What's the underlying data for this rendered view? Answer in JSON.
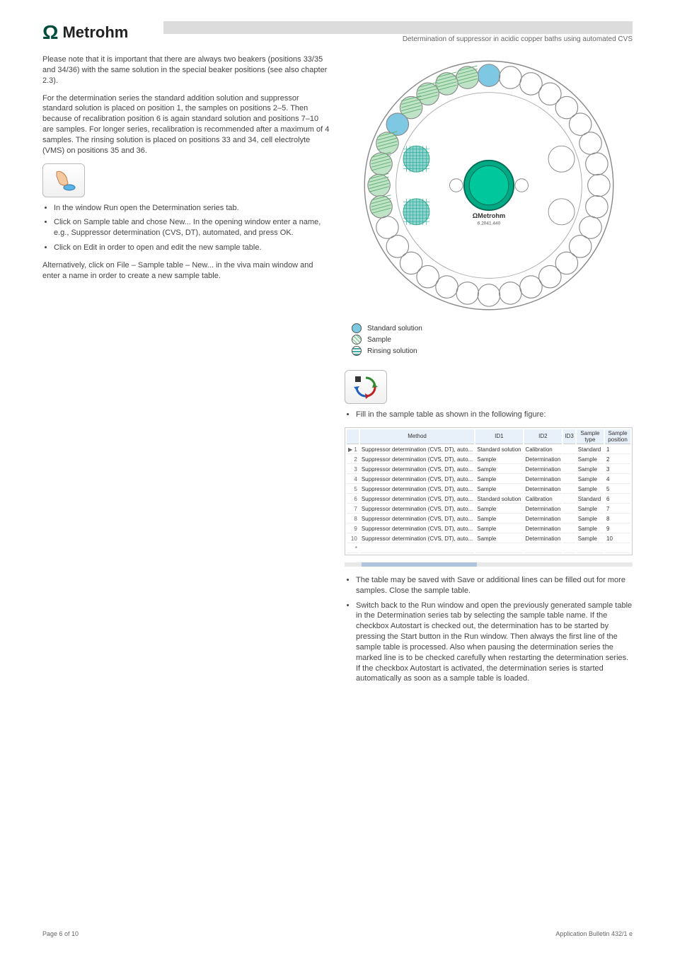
{
  "header": {
    "brand": "Metrohm",
    "subtitle": "Determination of suppressor in acidic copper baths using automated CVS"
  },
  "left": {
    "p1": "Please note that it is important that there are always two beakers (positions 33/35 and 34/36) with the same solution in the special beaker positions (see also chapter 2.3).",
    "p2": "For the determination series the standard addition solution and suppressor standard solution is placed on position 1, the samples on positions 2–5. Then because of recalibration position 6 is again standard solution and positions 7–10 are samples. For longer series, recalibration is recommended after a maximum of 4 samples. The rinsing solution is placed on positions 33 and 34, cell electrolyte (VMS) on positions 35 and 36.",
    "p3_heading": "",
    "list1": [
      "In the window Run open the Determination series tab.",
      "Click on Sample table and chose New... In the opening window enter a name, e.g., Suppressor determination (CVS, DT), automated, and press OK.",
      "Click on Edit in order to open and edit the new sample table."
    ],
    "p4": "Alternatively, click on File – Sample table – New... in the viva main window and enter a name in order to create a new sample table."
  },
  "right": {
    "carousel": {
      "brand_center": "Metrohm",
      "model": "6.2041.440",
      "std_positions": [
        1,
        6
      ],
      "sample_positions": [
        2,
        3,
        4,
        5,
        7,
        8,
        9,
        10
      ],
      "rinse_positions": [
        33,
        34
      ],
      "vms_positions": [
        35,
        36
      ],
      "total_outer": 32
    },
    "legend": {
      "std": "Standard solution",
      "sample": "Sample",
      "rinse": "Rinsing solution"
    },
    "list1": [
      "Fill in the sample table as shown in the following figure:"
    ],
    "table": {
      "headers": [
        "",
        "Method",
        "ID1",
        "ID2",
        "ID3",
        "Sample type",
        "Sample position"
      ],
      "rows": [
        [
          "1",
          "Suppressor determination (CVS, DT), auto...",
          "Standard solution",
          "Calibration",
          "",
          "Standard",
          "1"
        ],
        [
          "2",
          "Suppressor determination (CVS, DT), auto...",
          "Sample",
          "Determination",
          "",
          "Sample",
          "2"
        ],
        [
          "3",
          "Suppressor determination (CVS, DT), auto...",
          "Sample",
          "Determination",
          "",
          "Sample",
          "3"
        ],
        [
          "4",
          "Suppressor determination (CVS, DT), auto...",
          "Sample",
          "Determination",
          "",
          "Sample",
          "4"
        ],
        [
          "5",
          "Suppressor determination (CVS, DT), auto...",
          "Sample",
          "Determination",
          "",
          "Sample",
          "5"
        ],
        [
          "6",
          "Suppressor determination (CVS, DT), auto...",
          "Standard solution",
          "Calibration",
          "",
          "Standard",
          "6"
        ],
        [
          "7",
          "Suppressor determination (CVS, DT), auto...",
          "Sample",
          "Determination",
          "",
          "Sample",
          "7"
        ],
        [
          "8",
          "Suppressor determination (CVS, DT), auto...",
          "Sample",
          "Determination",
          "",
          "Sample",
          "8"
        ],
        [
          "9",
          "Suppressor determination (CVS, DT), auto...",
          "Sample",
          "Determination",
          "",
          "Sample",
          "9"
        ],
        [
          "10",
          "Suppressor determination (CVS, DT), auto...",
          "Sample",
          "Determination",
          "",
          "Sample",
          "10"
        ],
        [
          "*",
          "",
          "",
          "",
          "",
          "",
          ""
        ]
      ]
    },
    "list2": [
      "The table may be saved with Save or additional lines can be filled out for more samples. Close the sample table.",
      "Switch back to the Run window and open the previously generated sample table in the Determination series tab by selecting the sample table name. If the checkbox Autostart is checked out, the determination has to be started by pressing the Start button in the Run window. Then always the first line of the sample table is processed. Also when pausing the determination series the marked line is to be checked carefully when restarting the determination series. If the checkbox Autostart is activated, the determination series is started automatically as soon as a sample table is loaded."
    ]
  },
  "footer": {
    "left": "Page 6 of 10",
    "right": "Application Bulletin 432/1 e"
  }
}
